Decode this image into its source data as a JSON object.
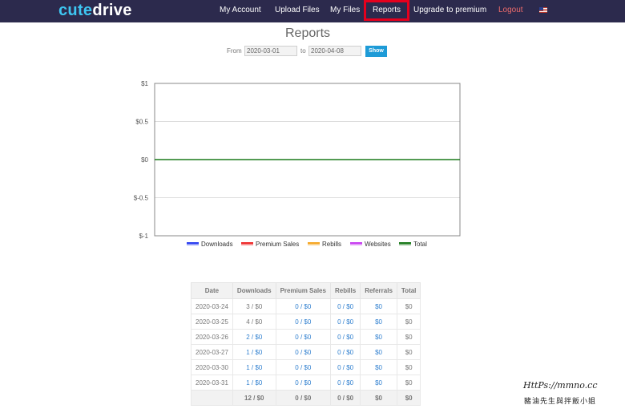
{
  "logo": {
    "part1": "cute",
    "part2": "drive"
  },
  "nav": {
    "my_account": "My Account",
    "upload_files": "Upload Files",
    "my_files": "My Files",
    "reports": "Reports",
    "upgrade": "Upgrade to premium",
    "logout": "Logout"
  },
  "page": {
    "title": "Reports"
  },
  "filter": {
    "from_label": "From",
    "from_value": "2020-03-01",
    "to_label": "to",
    "to_value": "2020-04-08",
    "show_label": "Show"
  },
  "chart_data": {
    "type": "line",
    "title": "",
    "xlabel": "",
    "ylabel": "",
    "ylim": [
      -1,
      1
    ],
    "yticks": [
      1,
      0.5,
      0,
      -0.5,
      -1
    ],
    "ytick_labels": [
      "$1",
      "$0.5",
      "$0",
      "$-0.5",
      "$-1"
    ],
    "grid": true,
    "legend_position": "bottom",
    "series": [
      {
        "name": "Downloads",
        "color": "#2b3ff0",
        "values": []
      },
      {
        "name": "Premium Sales",
        "color": "#ee2b2b",
        "values": []
      },
      {
        "name": "Rebills",
        "color": "#f5a623",
        "values": []
      },
      {
        "name": "Websites",
        "color": "#c73ef0",
        "values": []
      },
      {
        "name": "Total",
        "color": "#1a7a1a",
        "values": [
          0,
          0
        ]
      }
    ]
  },
  "table": {
    "headers": [
      "Date",
      "Downloads",
      "Premium Sales",
      "Rebills",
      "Referrals",
      "Total"
    ],
    "rows": [
      [
        "2020-03-24",
        "3 / $0",
        "0 / $0",
        "0 / $0",
        "$0",
        "$0"
      ],
      [
        "2020-03-25",
        "4 / $0",
        "0 / $0",
        "0 / $0",
        "$0",
        "$0"
      ],
      [
        "2020-03-26",
        "2 / $0",
        "0 / $0",
        "0 / $0",
        "$0",
        "$0"
      ],
      [
        "2020-03-27",
        "1 / $0",
        "0 / $0",
        "0 / $0",
        "$0",
        "$0"
      ],
      [
        "2020-03-30",
        "1 / $0",
        "0 / $0",
        "0 / $0",
        "$0",
        "$0"
      ],
      [
        "2020-03-31",
        "1 / $0",
        "0 / $0",
        "0 / $0",
        "$0",
        "$0"
      ]
    ],
    "link_cells": [
      [
        false,
        false,
        true,
        true,
        true,
        false
      ],
      [
        false,
        false,
        true,
        true,
        true,
        false
      ],
      [
        false,
        true,
        true,
        true,
        true,
        false
      ],
      [
        false,
        true,
        true,
        true,
        true,
        false
      ],
      [
        false,
        true,
        true,
        true,
        true,
        false
      ],
      [
        false,
        true,
        true,
        true,
        true,
        false
      ]
    ],
    "total_row": [
      "",
      "12 / $0",
      "0 / $0",
      "0 / $0",
      "$0",
      "$0"
    ]
  },
  "watermark": {
    "line1": "HttPs://mmno.cc",
    "line2": "豬油先生與拌飯小姐"
  }
}
